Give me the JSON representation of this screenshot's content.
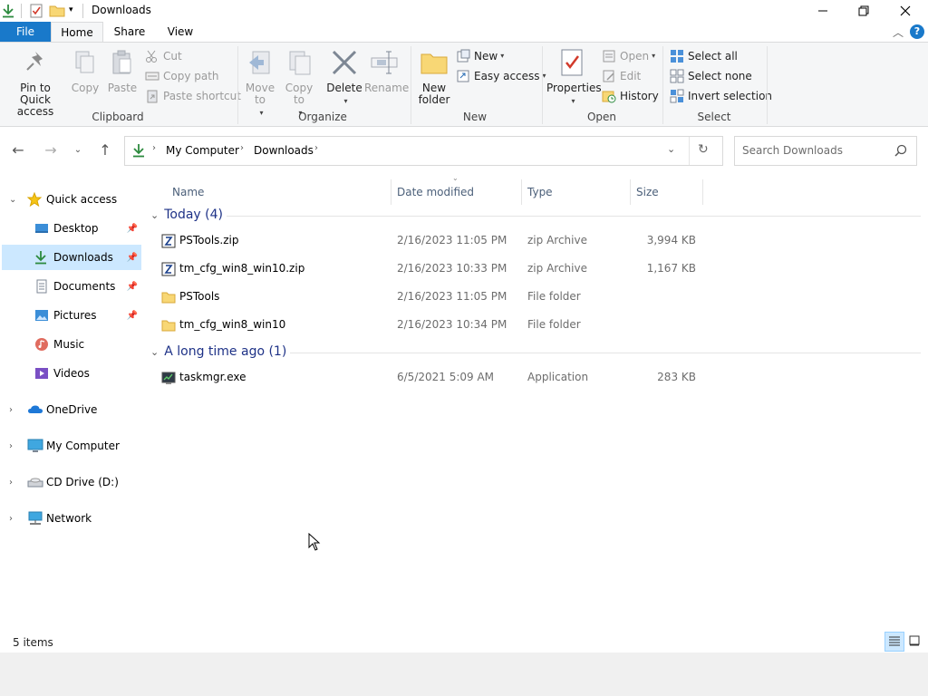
{
  "window": {
    "title": "Downloads"
  },
  "ribbon_tabs": {
    "file": "File",
    "home": "Home",
    "share": "Share",
    "view": "View"
  },
  "ribbon": {
    "clipboard": {
      "label": "Clipboard",
      "pin": "Pin to Quick access",
      "copy": "Copy",
      "paste": "Paste",
      "cut": "Cut",
      "copy_path": "Copy path",
      "paste_shortcut": "Paste shortcut"
    },
    "organize": {
      "label": "Organize",
      "move_to": "Move to",
      "copy_to": "Copy to",
      "delete": "Delete",
      "rename": "Rename"
    },
    "new": {
      "label": "New",
      "new_folder": "New folder",
      "new_item": "New",
      "easy_access": "Easy access"
    },
    "open": {
      "label": "Open",
      "properties": "Properties",
      "open": "Open",
      "edit": "Edit",
      "history": "History"
    },
    "select": {
      "label": "Select",
      "select_all": "Select all",
      "select_none": "Select none",
      "invert": "Invert selection"
    }
  },
  "address": {
    "path": [
      "My Computer",
      "Downloads"
    ],
    "search_placeholder": "Search Downloads"
  },
  "nav": {
    "quick_access": "Quick access",
    "desktop": "Desktop",
    "downloads": "Downloads",
    "documents": "Documents",
    "pictures": "Pictures",
    "music": "Music",
    "videos": "Videos",
    "onedrive": "OneDrive",
    "my_computer": "My Computer",
    "cd_drive": "CD Drive (D:)",
    "network": "Network"
  },
  "columns": {
    "name": "Name",
    "date": "Date modified",
    "type": "Type",
    "size": "Size"
  },
  "groups": [
    {
      "title": "Today (4)",
      "files": [
        {
          "name": "PSTools.zip",
          "date": "2/16/2023 11:05 PM",
          "type": "zip Archive",
          "size": "3,994 KB",
          "icon": "zip-icon"
        },
        {
          "name": "tm_cfg_win8_win10.zip",
          "date": "2/16/2023 10:33 PM",
          "type": "zip Archive",
          "size": "1,167 KB",
          "icon": "zip-icon"
        },
        {
          "name": "PSTools",
          "date": "2/16/2023 11:05 PM",
          "type": "File folder",
          "size": "",
          "icon": "folder-icon"
        },
        {
          "name": "tm_cfg_win8_win10",
          "date": "2/16/2023 10:34 PM",
          "type": "File folder",
          "size": "",
          "icon": "folder-icon"
        }
      ]
    },
    {
      "title": "A long time ago (1)",
      "files": [
        {
          "name": "taskmgr.exe",
          "date": "6/5/2021 5:09 AM",
          "type": "Application",
          "size": "283 KB",
          "icon": "app-icon"
        }
      ]
    }
  ],
  "status": {
    "count": "5 items"
  },
  "colors": {
    "accent": "#1979ca",
    "selected": "#cce8ff",
    "group_header": "#1e3287",
    "folder": "#f8d775"
  }
}
